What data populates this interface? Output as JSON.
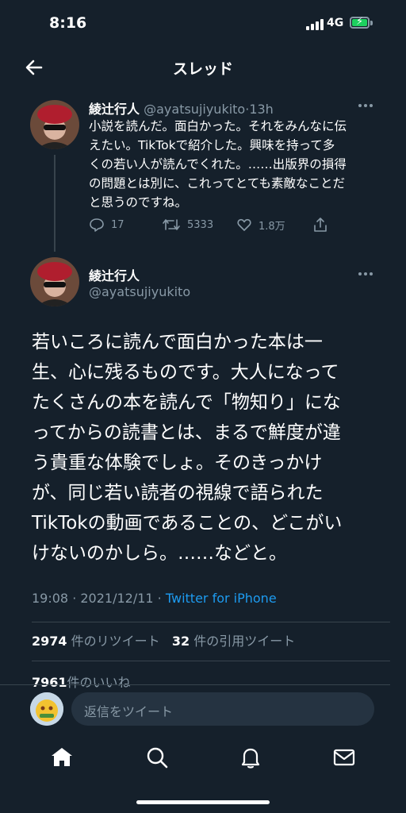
{
  "status_bar": {
    "time": "8:16",
    "network": "4G"
  },
  "header": {
    "title": "スレッド"
  },
  "parent_tweet": {
    "author_name": "綾辻行人",
    "author_handle": "@ayatsujiyukito",
    "age": "13h",
    "lines": [
      "小説を読んだ。面白かった。それをみんなに伝",
      "えたい。TikTokで紹介した。興味を持って多",
      "くの若い人が読んでくれた。……出版界の損得",
      "の問題とは別に、これってとても素敵なことだ",
      "と思うのですね。"
    ],
    "replies": "17",
    "retweets": "5333",
    "likes": "1.8万"
  },
  "main_tweet": {
    "author_name": "綾辻行人",
    "author_handle": "@ayatsujiyukito",
    "lines": [
      "若いころに読んで面白かった本は一",
      "生、心に残るものです。大人になって",
      "たくさんの本を読んで「物知り」にな",
      "ってからの読書とは、まるで鮮度が違",
      "う貴重な体験でしょ。そのきっかけ",
      "が、同じ若い読者の視線で語られた",
      "TikTokの動画であることの、どこがい",
      "けないのかしら。……などと。"
    ],
    "time": "19:08",
    "date": "2021/12/11",
    "source": "Twitter for iPhone",
    "retweet_count": "2974",
    "retweet_label": "件のリツイート",
    "quote_count": "32",
    "quote_label": "件の引用ツイート",
    "like_count": "7961",
    "like_label": "件のいいね"
  },
  "reply_bar": {
    "placeholder": "返信をツイート"
  },
  "colors": {
    "background": "#15202b",
    "secondary_text": "#8899a6",
    "accent": "#1d9bf0",
    "divider": "#38444d",
    "battery": "#1dd05f"
  },
  "icons": [
    "back-arrow-icon",
    "more-icon",
    "reply-icon",
    "retweet-icon",
    "like-icon",
    "share-icon",
    "home-icon",
    "search-icon",
    "notifications-icon",
    "messages-icon"
  ]
}
